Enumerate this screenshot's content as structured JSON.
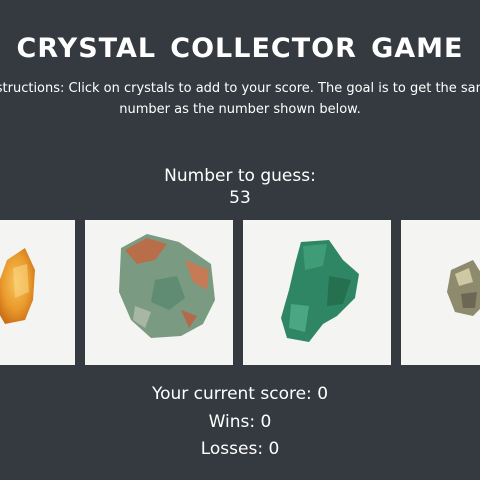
{
  "game": {
    "title": "Crystal Collector Game",
    "instructions": "Instructions: Click on crystals to add to your score. The goal is to get the same number as the number shown below.",
    "target_label": "Number to guess:",
    "target_number": "53"
  },
  "crystals": [
    {
      "name": "orange-crystal",
      "color": "#e8952a"
    },
    {
      "name": "green-copper-crystal",
      "color": "#6f9a7c"
    },
    {
      "name": "malachite-crystal",
      "color": "#2f8a6a"
    },
    {
      "name": "pyrite-crystal",
      "color": "#9c9478"
    }
  ],
  "stats": {
    "score_label": "Your current score: ",
    "score": "0",
    "wins_label": "Wins: ",
    "wins": "0",
    "losses_label": "Losses: ",
    "losses": "0"
  },
  "colors": {
    "background": "#343a40",
    "text": "#ffffff",
    "tile": "#f4f4f2"
  }
}
